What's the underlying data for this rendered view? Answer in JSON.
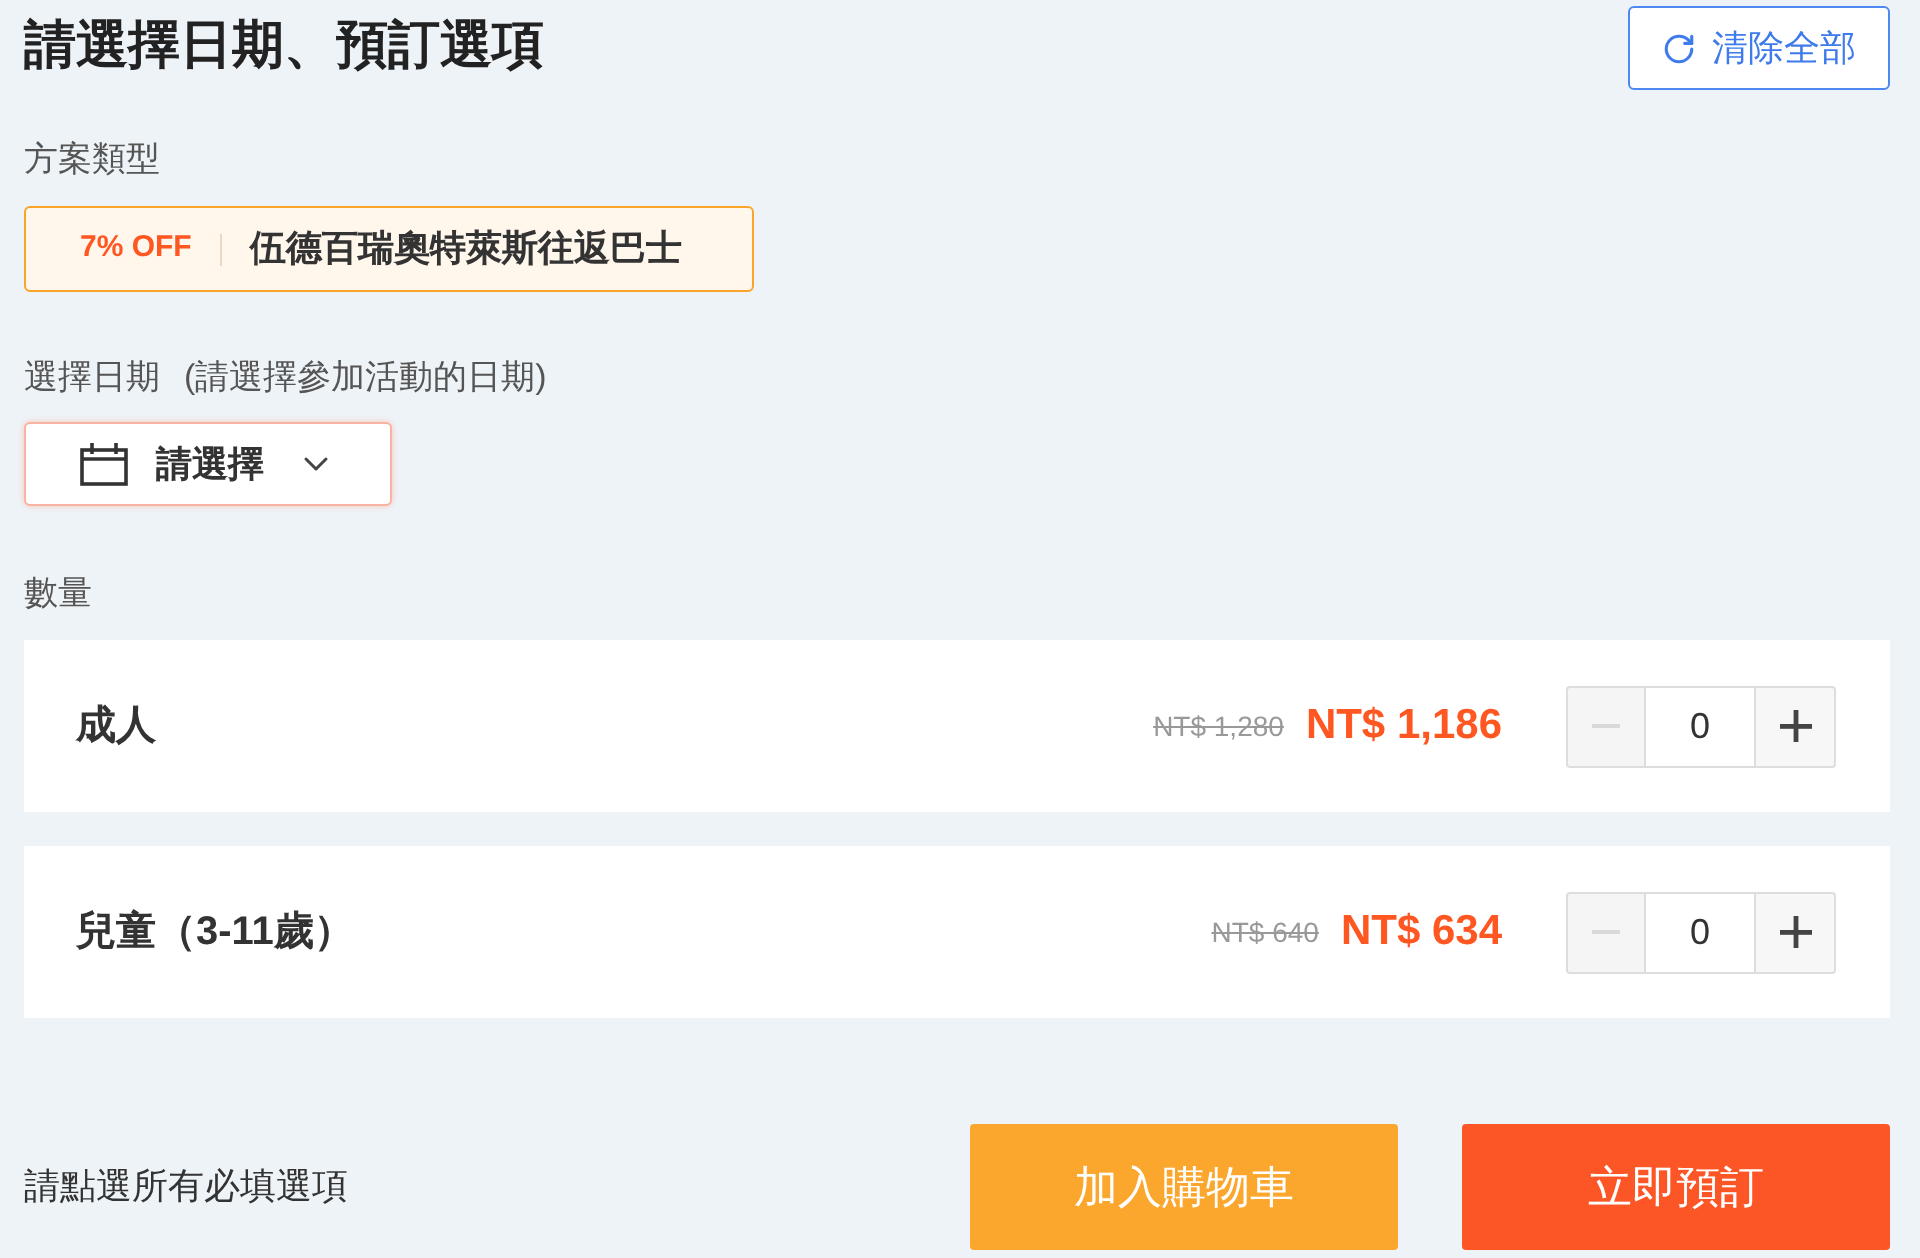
{
  "title": "請選擇日期、預訂選項",
  "clear_button": {
    "label": "清除全部"
  },
  "package": {
    "label": "方案類型",
    "options": [
      {
        "discount": "7% OFF",
        "name": "伍德百瑞奧特萊斯往返巴士",
        "selected": true
      }
    ]
  },
  "date": {
    "label": "選擇日期",
    "hint": "(請選擇參加活動的日期)",
    "placeholder": "請選擇",
    "invalid": true
  },
  "quantity": {
    "label": "數量",
    "rows": [
      {
        "name": "成人",
        "original_price": "NT$ 1,280",
        "price": "NT$ 1,186",
        "value": "0",
        "decrease_disabled": true
      },
      {
        "name": "兒童（3-11歲）",
        "original_price": "NT$ 640",
        "price": "NT$ 634",
        "value": "0",
        "decrease_disabled": true
      }
    ]
  },
  "footer": {
    "message": "請點選所有必填選項",
    "buttons": [
      {
        "label": "加入購物車",
        "kind": "cart"
      },
      {
        "label": "立即預訂",
        "kind": "book"
      }
    ]
  }
}
